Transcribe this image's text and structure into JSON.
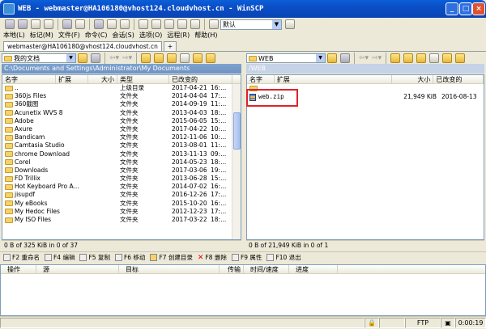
{
  "window": {
    "title": "WEB - webmaster@HA106180@vhost124.cloudvhost.cn - WinSCP"
  },
  "toolbar": {
    "session_select": "默认"
  },
  "menu": [
    "本地(L)",
    "标记(M)",
    "文件(F)",
    "命令(C)",
    "会话(S)",
    "选项(O)",
    "远程(R)",
    "帮助(H)"
  ],
  "tabs": {
    "session": "webmaster@HA106180@vhost124.cloudvhost.cn",
    "add": "+"
  },
  "local": {
    "path_combo": "我的文档",
    "path": "C:\\Documents and Settings\\Administrator\\My Documents",
    "columns": [
      "名字",
      "扩展",
      "大小",
      "类型",
      "已改变的"
    ],
    "rows": [
      {
        "name": "..",
        "type": "上级目录",
        "date": "2017-04-21",
        "time": "16:..."
      },
      {
        "name": "360js Files",
        "type": "文件夹",
        "date": "2014-04-04",
        "time": "17:..."
      },
      {
        "name": "360截图",
        "type": "文件夹",
        "date": "2014-09-19",
        "time": "11:..."
      },
      {
        "name": "Acunetix WVS 8",
        "type": "文件夹",
        "date": "2013-04-03",
        "time": "18:..."
      },
      {
        "name": "Adobe",
        "type": "文件夹",
        "date": "2015-06-05",
        "time": "15:..."
      },
      {
        "name": "Axure",
        "type": "文件夹",
        "date": "2017-04-22",
        "time": "10:..."
      },
      {
        "name": "Bandicam",
        "type": "文件夹",
        "date": "2012-11-06",
        "time": "10:..."
      },
      {
        "name": "Camtasia Studio",
        "type": "文件夹",
        "date": "2013-08-01",
        "time": "11:..."
      },
      {
        "name": "chrome Download",
        "type": "文件夹",
        "date": "2013-11-13",
        "time": "09:..."
      },
      {
        "name": "Corel",
        "type": "文件夹",
        "date": "2014-05-23",
        "time": "18:..."
      },
      {
        "name": "Downloads",
        "type": "文件夹",
        "date": "2017-03-06",
        "time": "19:..."
      },
      {
        "name": "FD Trillix",
        "type": "文件夹",
        "date": "2013-06-28",
        "time": "15:..."
      },
      {
        "name": "Hot Keyboard Pro A...",
        "type": "文件夹",
        "date": "2014-07-02",
        "time": "16:..."
      },
      {
        "name": "jisupdf",
        "type": "文件夹",
        "date": "2016-12-26",
        "time": "17:..."
      },
      {
        "name": "My eBooks",
        "type": "文件夹",
        "date": "2015-10-20",
        "time": "16:..."
      },
      {
        "name": "My Hedoc Files",
        "type": "文件夹",
        "date": "2012-12-23",
        "time": "17:..."
      },
      {
        "name": "My ISO Files",
        "type": "文件夹",
        "date": "2017-03-22",
        "time": "18:..."
      }
    ],
    "status": "0 B of 325 KiB in 0 of 37"
  },
  "remote": {
    "path_combo": "WEB",
    "path": "/WEB",
    "columns": [
      "名字",
      "扩展",
      "大小",
      "已改变的"
    ],
    "rows": [
      {
        "name": "..",
        "size": "",
        "date": ""
      },
      {
        "name": "web.zip",
        "size": "21,949 KiB",
        "date": "2016-08-13"
      }
    ],
    "status": "0 B of 21,949 KiB in 0 of 1"
  },
  "fkeys": [
    {
      "label": "F2 重命名",
      "icon": "rename-icon"
    },
    {
      "label": "F4 编辑",
      "icon": "edit-icon"
    },
    {
      "label": "F5 复制",
      "icon": "copy-icon"
    },
    {
      "label": "F6 移动",
      "icon": "move-icon"
    },
    {
      "label": "F7 创建目录",
      "icon": "create-folder-icon"
    },
    {
      "label": "F8 删除",
      "icon": "delete-icon"
    },
    {
      "label": "F9 属性",
      "icon": "properties-icon"
    },
    {
      "label": "F10 退出",
      "icon": "exit-icon"
    }
  ],
  "queue": {
    "columns": [
      "操作",
      "源",
      "目标",
      "传输",
      "时间/速度",
      "进度"
    ]
  },
  "statusbar": {
    "protocol": "FTP",
    "time": "0:00:19"
  },
  "colors": {
    "title_bar": "#0b4ec6",
    "active_path": "#6f93c4",
    "highlight": "#e0202c",
    "folder": "#f6d26a"
  }
}
